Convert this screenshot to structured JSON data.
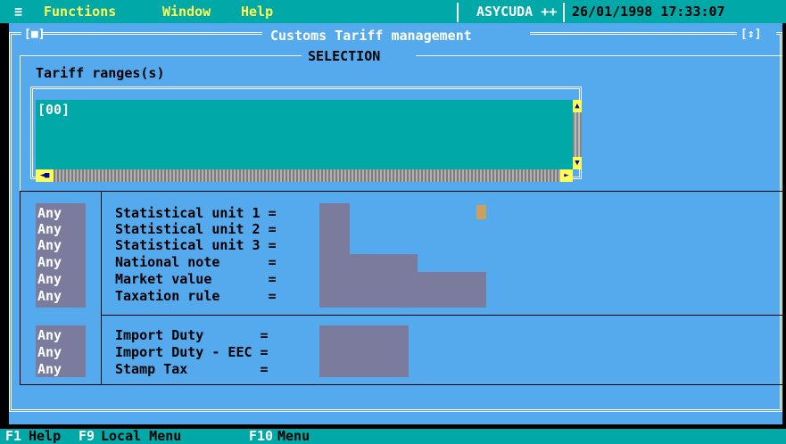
{
  "menubar": {
    "system_icon": "≡",
    "items": [
      "Functions",
      "Window",
      "Help"
    ],
    "app_name": "ASYCUDA ++",
    "datetime": "26/01/1998 17:33:07"
  },
  "window": {
    "title": "Customs Tariff management",
    "close_icon": "[■]",
    "zoom_icon": "[↕]",
    "section_title": "SELECTION"
  },
  "ranges": {
    "label": "Tariff ranges(s)",
    "items": [
      "[00]"
    ]
  },
  "criteria1": [
    {
      "mode": "Any",
      "label": "Statistical unit 1 ="
    },
    {
      "mode": "Any",
      "label": "Statistical unit 2 ="
    },
    {
      "mode": "Any",
      "label": "Statistical unit 3 ="
    },
    {
      "mode": "Any",
      "label": "National note      ="
    },
    {
      "mode": "Any",
      "label": "Market value       ="
    },
    {
      "mode": "Any",
      "label": "Taxation rule      ="
    }
  ],
  "criteria2": [
    {
      "mode": "Any",
      "label": "Import Duty       ="
    },
    {
      "mode": "Any",
      "label": "Import Duty - EEC ="
    },
    {
      "mode": "Any",
      "label": "Stamp Tax         ="
    }
  ],
  "statusbar": {
    "f1": "F1",
    "f1_label": "Help",
    "f9": "F9",
    "f9_label": "Local Menu",
    "f10": "F10",
    "f10_label": "Menu"
  },
  "colors": {
    "menu_bg": "#00a8a8",
    "window_bg": "#55aaee",
    "field_bg": "#7b7b9e",
    "highlight": "#ffff55"
  }
}
